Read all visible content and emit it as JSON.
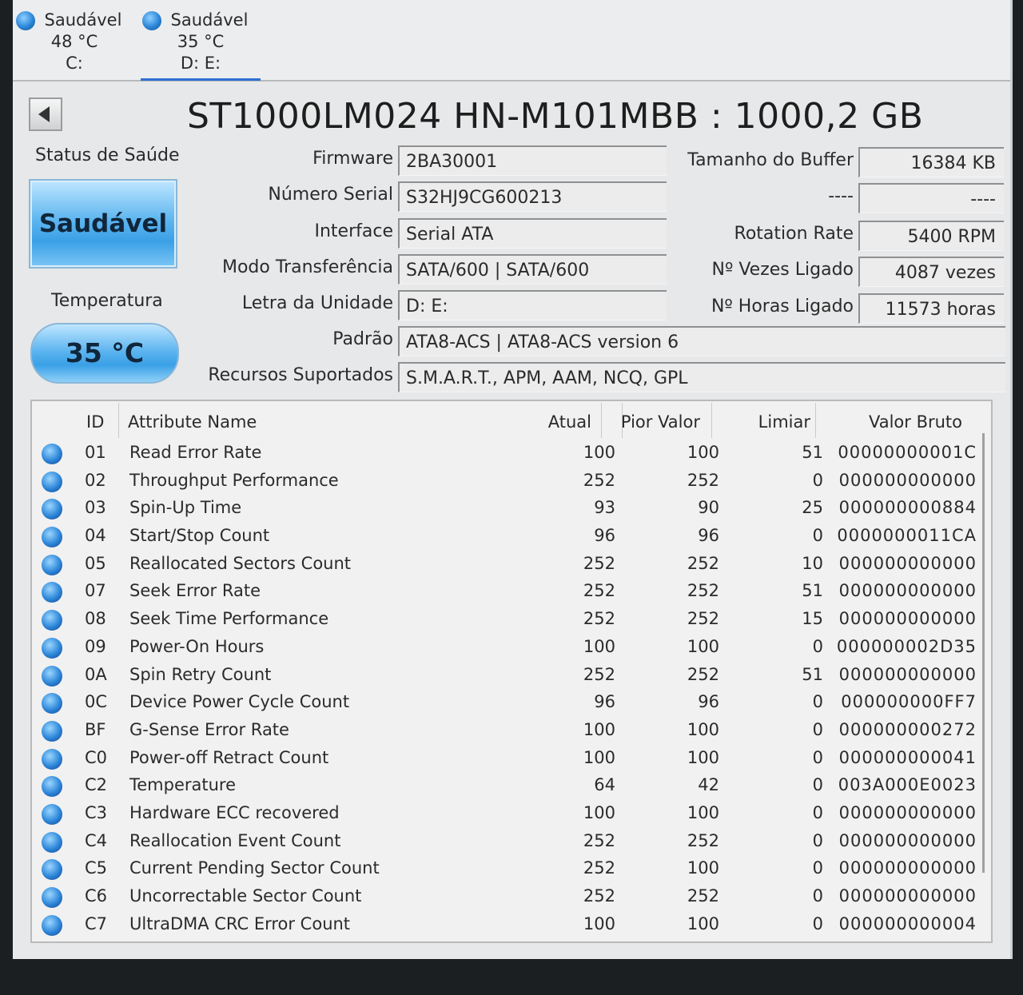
{
  "drive_tabs": [
    {
      "status": "Saudável",
      "temp": "48 °C",
      "letters": "C:"
    },
    {
      "status": "Saudável",
      "temp": "35 °C",
      "letters": "D: E:"
    }
  ],
  "disk_title": "ST1000LM024 HN-M101MBB : 1000,2 GB",
  "health": {
    "label": "Status de Saúde",
    "value": "Saudável"
  },
  "temperature": {
    "label": "Temperatura",
    "value": "35 °C"
  },
  "info_left": [
    {
      "label": "Firmware",
      "value": "2BA30001"
    },
    {
      "label": "Número Serial",
      "value": "S32HJ9CG600213"
    },
    {
      "label": "Interface",
      "value": "Serial ATA"
    },
    {
      "label": "Modo Transferência",
      "value": "SATA/600 | SATA/600"
    },
    {
      "label": "Letra da Unidade",
      "value": "D: E:"
    }
  ],
  "info_right": [
    {
      "label": "Tamanho do Buffer",
      "value": "16384 KB"
    },
    {
      "label": "----",
      "value": "----"
    },
    {
      "label": "Rotation Rate",
      "value": "5400 RPM"
    },
    {
      "label": "Nº Vezes Ligado",
      "value": "4087 vezes"
    },
    {
      "label": "Nº Horas Ligado",
      "value": "11573 horas"
    }
  ],
  "info_wide": [
    {
      "label": "Padrão",
      "value": "ATA8-ACS | ATA8-ACS version 6"
    },
    {
      "label": "Recursos Suportados",
      "value": "S.M.A.R.T., APM, AAM, NCQ, GPL"
    }
  ],
  "smart_table": {
    "columns": {
      "id": "ID",
      "name": "Attribute Name",
      "current": "Atual",
      "worst": "Pior Valor",
      "threshold": "Limiar",
      "raw": "Valor Bruto"
    },
    "rows": [
      {
        "id": "01",
        "name": "Read Error Rate",
        "current": "100",
        "worst": "100",
        "threshold": "51",
        "raw": "00000000001C"
      },
      {
        "id": "02",
        "name": "Throughput Performance",
        "current": "252",
        "worst": "252",
        "threshold": "0",
        "raw": "000000000000"
      },
      {
        "id": "03",
        "name": "Spin-Up Time",
        "current": "93",
        "worst": "90",
        "threshold": "25",
        "raw": "000000000884"
      },
      {
        "id": "04",
        "name": "Start/Stop Count",
        "current": "96",
        "worst": "96",
        "threshold": "0",
        "raw": "0000000011CA"
      },
      {
        "id": "05",
        "name": "Reallocated Sectors Count",
        "current": "252",
        "worst": "252",
        "threshold": "10",
        "raw": "000000000000"
      },
      {
        "id": "07",
        "name": "Seek Error Rate",
        "current": "252",
        "worst": "252",
        "threshold": "51",
        "raw": "000000000000"
      },
      {
        "id": "08",
        "name": "Seek Time Performance",
        "current": "252",
        "worst": "252",
        "threshold": "15",
        "raw": "000000000000"
      },
      {
        "id": "09",
        "name": "Power-On Hours",
        "current": "100",
        "worst": "100",
        "threshold": "0",
        "raw": "000000002D35"
      },
      {
        "id": "0A",
        "name": "Spin Retry Count",
        "current": "252",
        "worst": "252",
        "threshold": "51",
        "raw": "000000000000"
      },
      {
        "id": "0C",
        "name": "Device Power Cycle Count",
        "current": "96",
        "worst": "96",
        "threshold": "0",
        "raw": "000000000FF7"
      },
      {
        "id": "BF",
        "name": "G-Sense Error Rate",
        "current": "100",
        "worst": "100",
        "threshold": "0",
        "raw": "000000000272"
      },
      {
        "id": "C0",
        "name": "Power-off Retract Count",
        "current": "100",
        "worst": "100",
        "threshold": "0",
        "raw": "000000000041"
      },
      {
        "id": "C2",
        "name": "Temperature",
        "current": "64",
        "worst": "42",
        "threshold": "0",
        "raw": "003A000E0023"
      },
      {
        "id": "C3",
        "name": "Hardware ECC recovered",
        "current": "100",
        "worst": "100",
        "threshold": "0",
        "raw": "000000000000"
      },
      {
        "id": "C4",
        "name": "Reallocation Event Count",
        "current": "252",
        "worst": "252",
        "threshold": "0",
        "raw": "000000000000"
      },
      {
        "id": "C5",
        "name": "Current Pending Sector Count",
        "current": "252",
        "worst": "100",
        "threshold": "0",
        "raw": "000000000000"
      },
      {
        "id": "C6",
        "name": "Uncorrectable Sector Count",
        "current": "252",
        "worst": "252",
        "threshold": "0",
        "raw": "000000000000"
      },
      {
        "id": "C7",
        "name": "UltraDMA CRC Error Count",
        "current": "100",
        "worst": "100",
        "threshold": "0",
        "raw": "000000000004"
      }
    ]
  }
}
